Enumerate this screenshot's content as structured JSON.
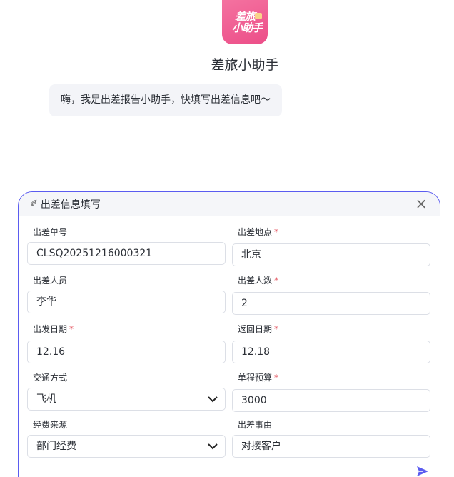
{
  "app": {
    "logo_line1": "差旅",
    "logo_line2": "小助手",
    "title": "差旅小助手"
  },
  "greeting": "嗨，我是出差报告小助手，快填写出差信息吧～",
  "form": {
    "title": "出差信息填写",
    "fields": {
      "trip_number": {
        "label": "出差单号",
        "required": false,
        "value": "CLSQ20251216000321"
      },
      "location": {
        "label": "出差地点",
        "required": true,
        "value": "北京"
      },
      "travelers": {
        "label": "出差人员",
        "required": false,
        "value": "李华"
      },
      "traveler_count": {
        "label": "出差人数",
        "required": true,
        "value": "2"
      },
      "depart_date": {
        "label": "出发日期",
        "required": true,
        "value": "12.16"
      },
      "return_date": {
        "label": "返回日期",
        "required": true,
        "value": "12.18"
      },
      "transport": {
        "label": "交通方式",
        "required": false,
        "value": "飞机"
      },
      "budget": {
        "label": "单程预算",
        "required": true,
        "value": "3000"
      },
      "fund_source": {
        "label": "经费来源",
        "required": false,
        "value": "部门经费"
      },
      "purpose": {
        "label": "出差事由",
        "required": false,
        "value": "对接客户"
      }
    },
    "required_mark": "*"
  },
  "colors": {
    "accent": "#5b5cf0",
    "logo": "#ec4e88",
    "required": "#e34d59"
  }
}
